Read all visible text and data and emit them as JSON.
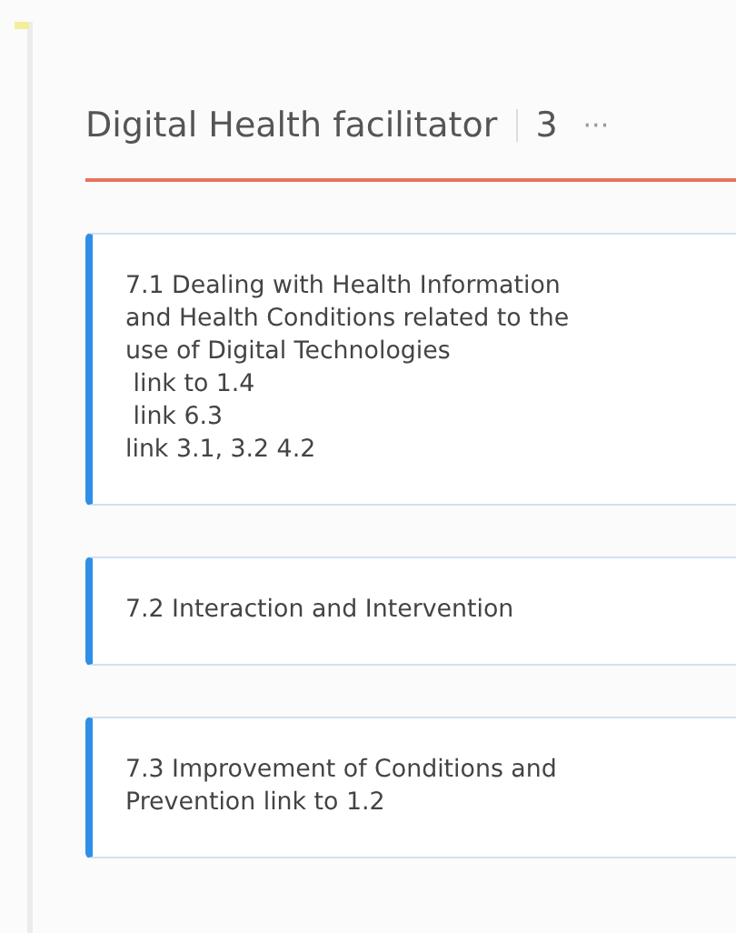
{
  "bucket": {
    "title": "Digital Health facilitator",
    "count": "3",
    "menu": "···"
  },
  "cards": [
    {
      "lines": [
        "7.1 Dealing with Health Information",
        "and Health Conditions related to the",
        "use of Digital Technologies",
        " link to 1.4",
        " link 6.3",
        "link 3.1, 3.2 4.2"
      ]
    },
    {
      "lines": [
        "7.2 Interaction and Intervention"
      ]
    },
    {
      "lines": [
        "7.3 Improvement of Conditions and",
        "Prevention link to 1.2"
      ]
    }
  ]
}
